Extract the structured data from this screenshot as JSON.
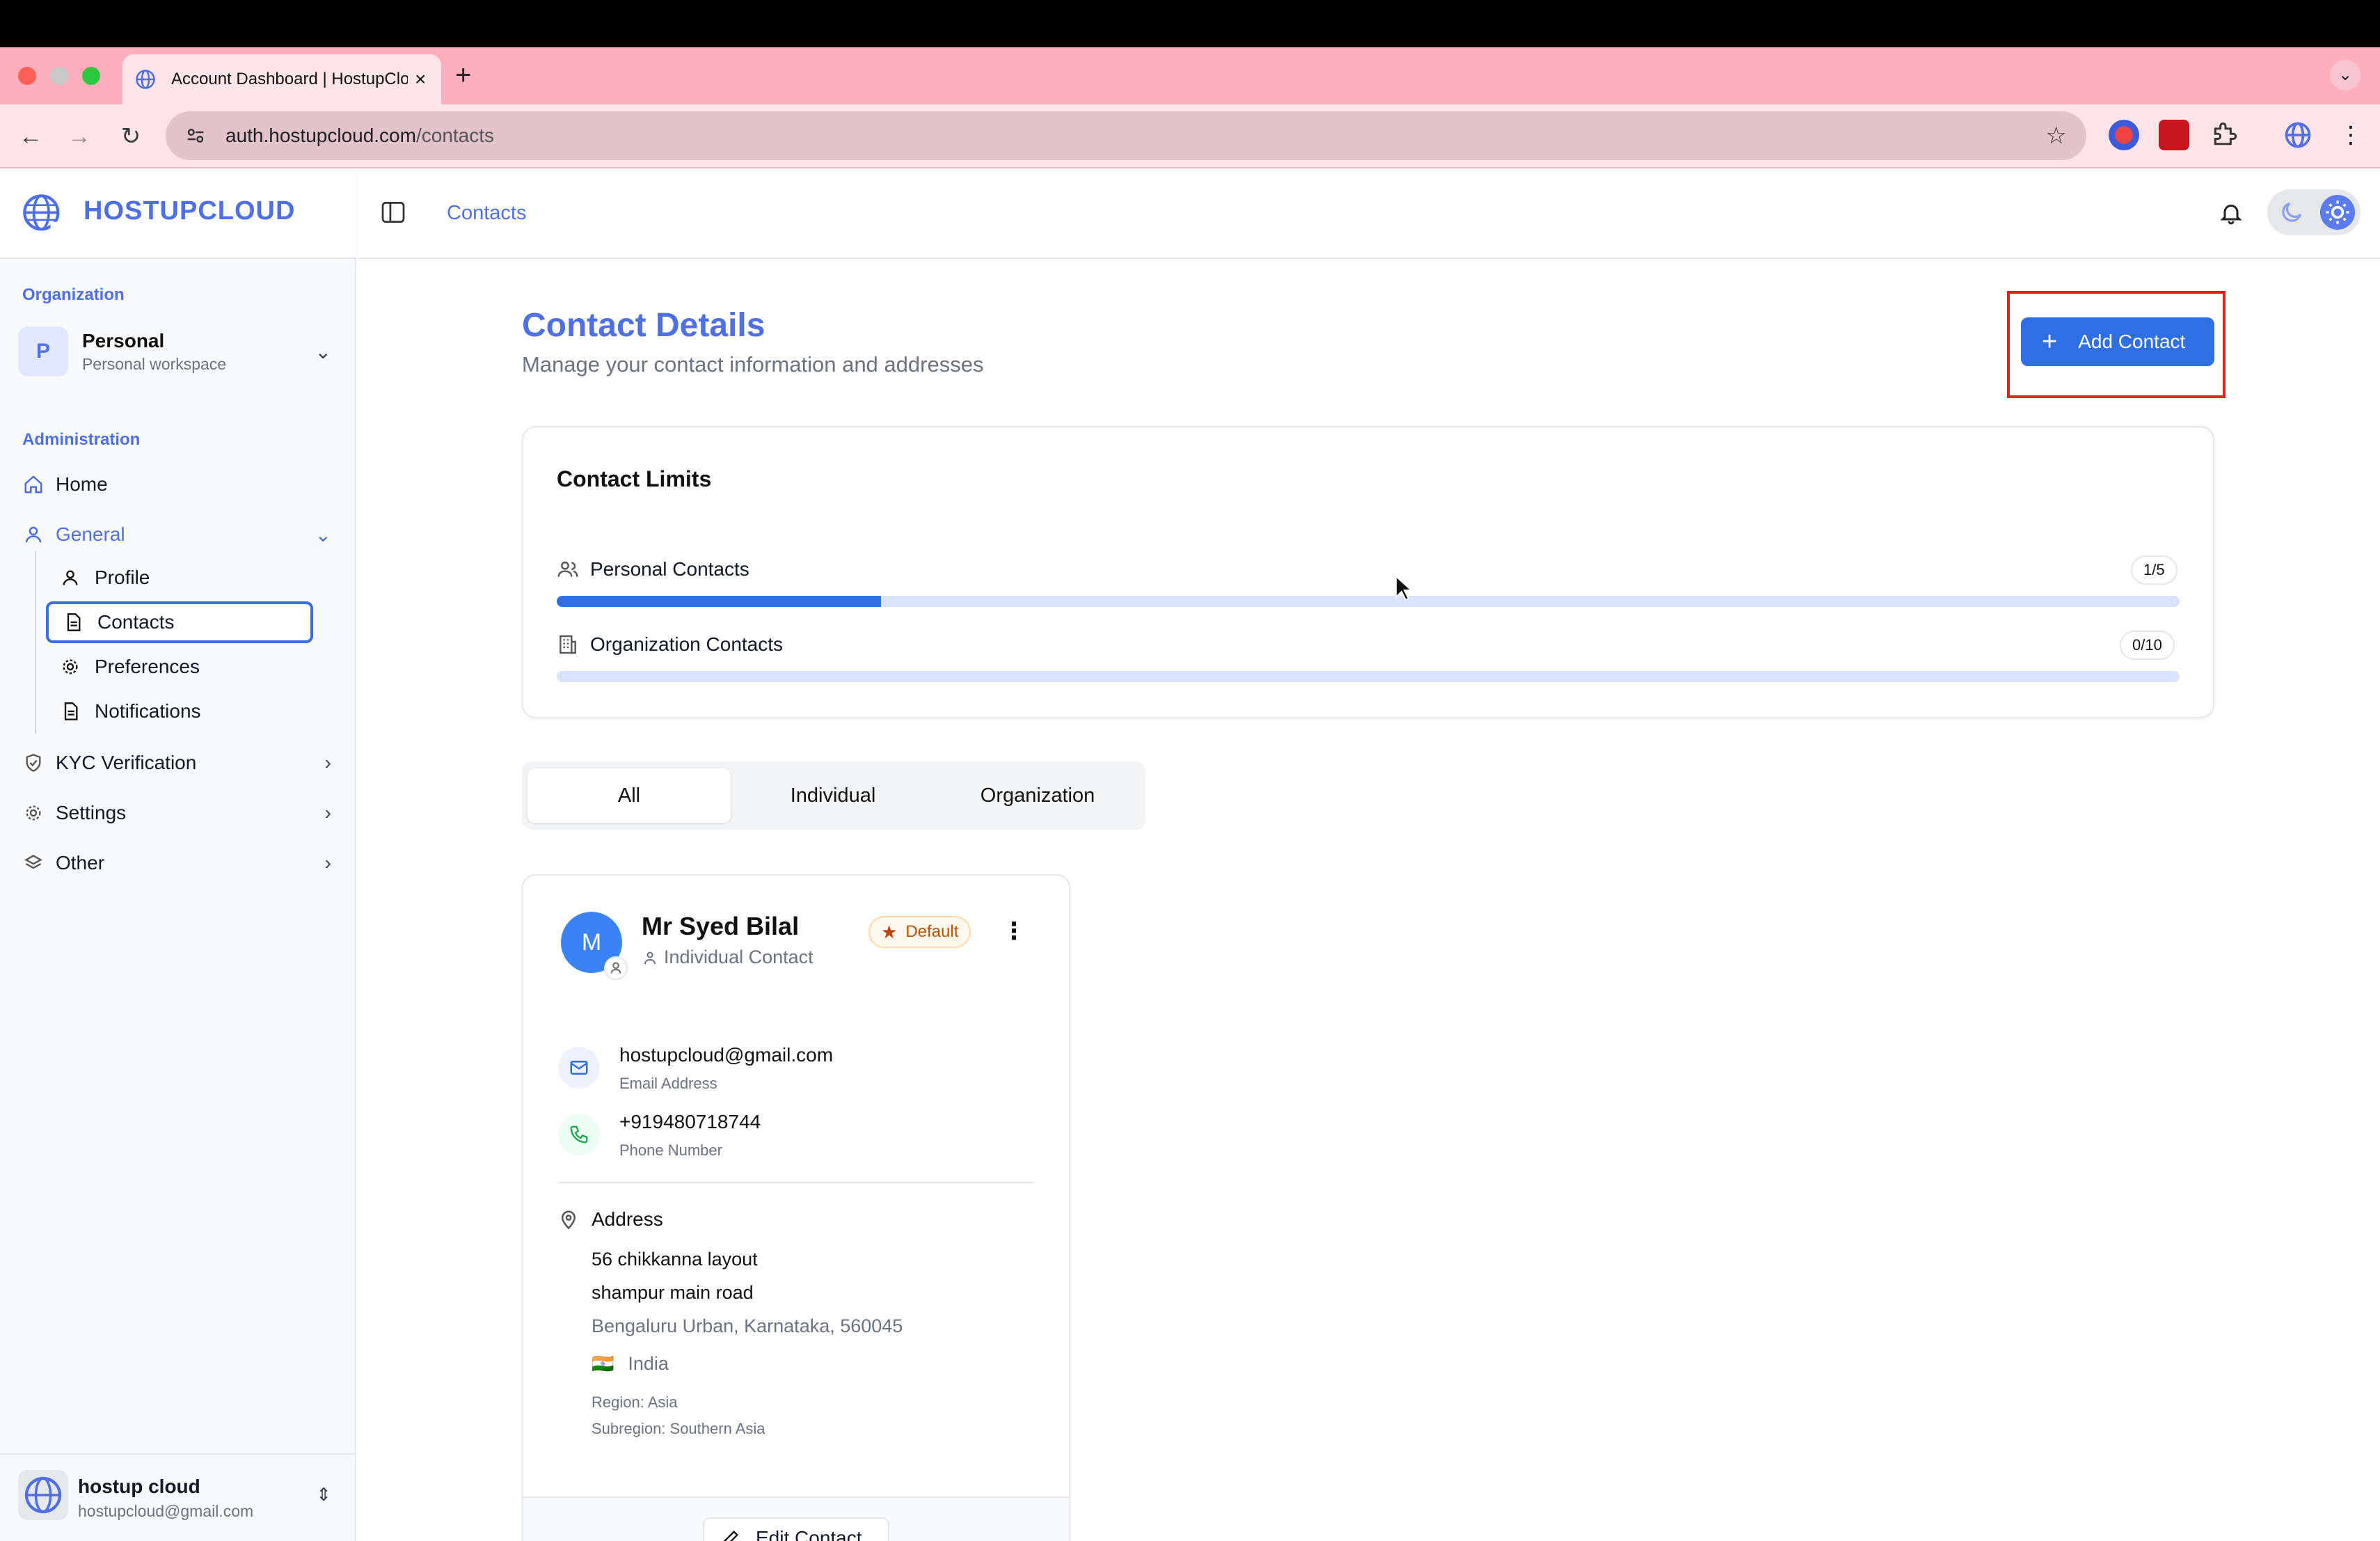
{
  "browser": {
    "tab_title": "Account Dashboard | HostupCloud",
    "url_host": "auth.hostupcloud.com",
    "url_path": "/contacts",
    "new_tab": "+",
    "tab_close": "×"
  },
  "brand": {
    "name": "HOSTUPCLOUD"
  },
  "sidebar": {
    "org_label": "Organization",
    "org": {
      "initial": "P",
      "name": "Personal",
      "subtitle": "Personal workspace"
    },
    "admin_label": "Administration",
    "items": [
      {
        "label": "Home"
      },
      {
        "label": "General"
      },
      {
        "label": "KYC Verification"
      },
      {
        "label": "Settings"
      },
      {
        "label": "Other"
      }
    ],
    "sub_items": [
      {
        "label": "Profile"
      },
      {
        "label": "Contacts"
      },
      {
        "label": "Preferences"
      },
      {
        "label": "Notifications"
      }
    ],
    "user": {
      "name": "hostup cloud",
      "email": "hostupcloud@gmail.com"
    }
  },
  "header": {
    "breadcrumb": "Contacts"
  },
  "page": {
    "title": "Contact Details",
    "subtitle": "Manage your contact information and addresses",
    "add_button": "Add Contact"
  },
  "limits": {
    "title": "Contact Limits",
    "personal": {
      "label": "Personal Contacts",
      "badge": "1/5",
      "fraction": 0.2
    },
    "organization": {
      "label": "Organization Contacts",
      "badge": "0/10",
      "fraction": 0
    }
  },
  "tabs": [
    {
      "label": "All"
    },
    {
      "label": "Individual"
    },
    {
      "label": "Organization"
    }
  ],
  "contact": {
    "initial": "M",
    "name": "Mr Syed Bilal",
    "type": "Individual Contact",
    "badge": "Default",
    "email": "hostupcloud@gmail.com",
    "email_label": "Email Address",
    "phone": "+919480718744",
    "phone_label": "Phone Number",
    "address_label": "Address",
    "address_line1": "56 chikkanna layout",
    "address_line2": "shampur main road",
    "address_city": "Bengaluru Urban, Karnataka, 560045",
    "country_flag": "🇮🇳",
    "country": "India",
    "region": "Region: Asia",
    "subregion": "Subregion: Southern Asia",
    "edit_button": "Edit Contact"
  },
  "colors": {
    "accent": "#4f6fe8",
    "button": "#2f6fe6",
    "highlight": "#e3211c",
    "tabstrip": "#fdafbe"
  }
}
